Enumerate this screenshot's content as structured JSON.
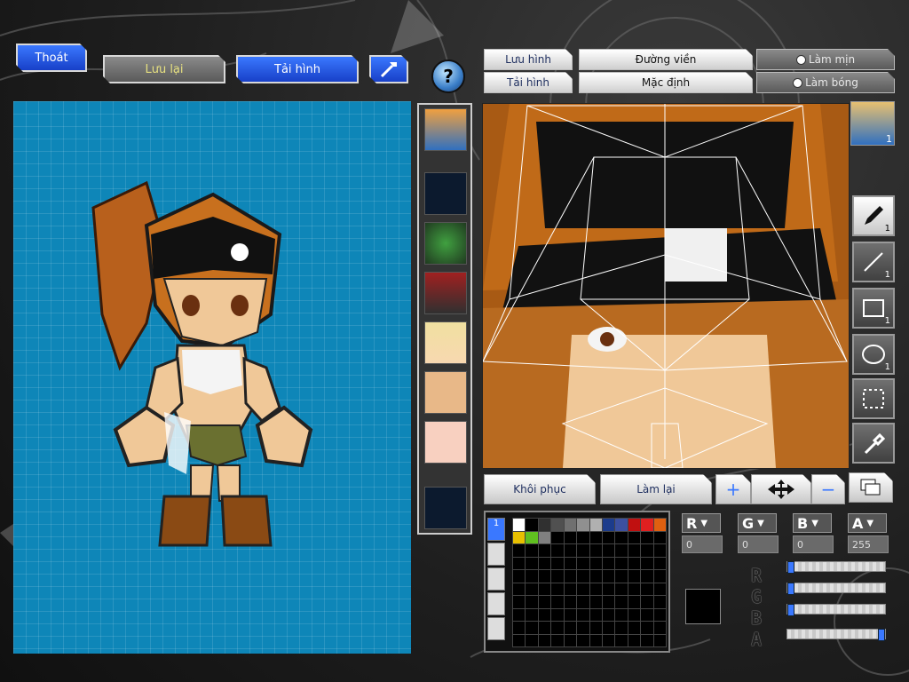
{
  "top_buttons": {
    "exit": "Thoát",
    "save": "Lưu lại",
    "load": "Tải hình",
    "help": "?"
  },
  "right_tabs": {
    "save_image": "Lưu hình",
    "load_image": "Tải hình",
    "outline": "Đường viền",
    "default": "Mặc định",
    "smooth": "Làm mịn",
    "glossy": "Làm bóng"
  },
  "tools": {
    "pen_count": "1",
    "line_count": "1",
    "rect_count": "1",
    "ellipse_count": "1",
    "face_count": "1"
  },
  "actions": {
    "restore": "Khôi phục",
    "redo": "Làm lại"
  },
  "palette": {
    "tab_active_label": "1",
    "first_row_colors": [
      "#ffffff",
      "#000000",
      "#303030",
      "#505050",
      "#707070",
      "#909090",
      "#b0b0b0",
      "#1c3c8c",
      "#3c50a0",
      "#c01010",
      "#e02020",
      "#e06010",
      "#f09020"
    ],
    "second_row_colors": [
      "#e8c000",
      "#60c020",
      "#808080"
    ]
  },
  "color_channels": {
    "r_label": "R",
    "g_label": "G",
    "b_label": "B",
    "a_label": "A",
    "r_value": "0",
    "g_value": "0",
    "b_value": "0",
    "a_value": "255",
    "r_level": 0,
    "g_level": 0,
    "b_level": 0,
    "a_level": 1.0
  },
  "current_color": "#000000",
  "canvas_bg_color": "#0e86b8"
}
